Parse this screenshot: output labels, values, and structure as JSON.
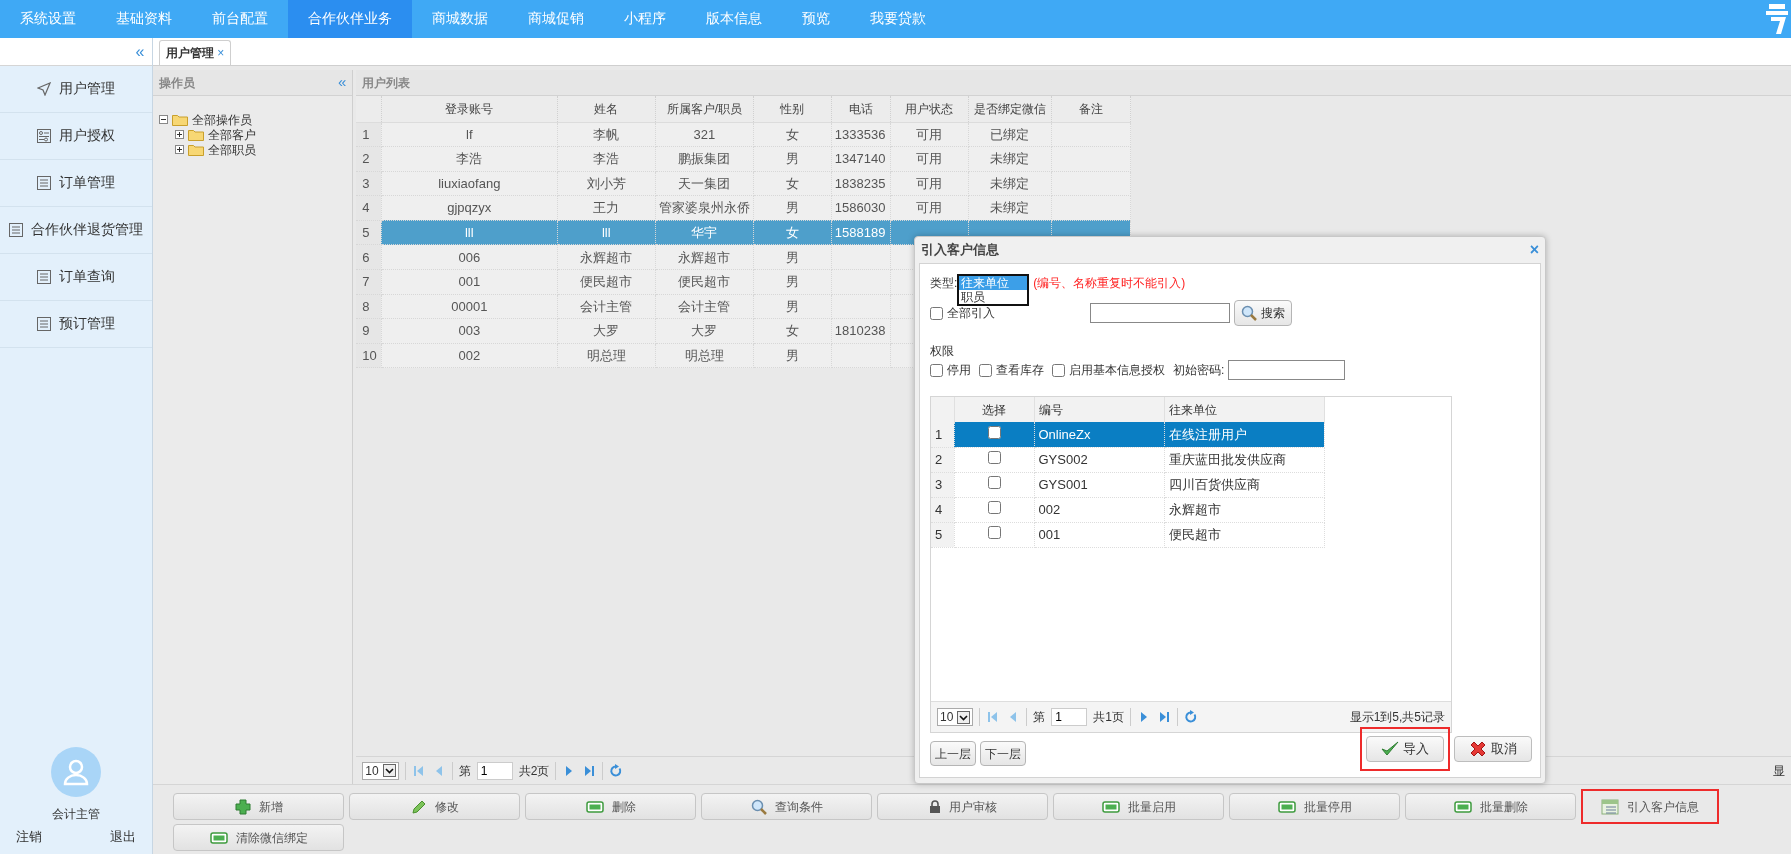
{
  "top_nav": {
    "items": [
      {
        "label": "系统设置",
        "selected": false
      },
      {
        "label": "基础资料",
        "selected": false
      },
      {
        "label": "前台配置",
        "selected": false
      },
      {
        "label": "合作伙伴业务",
        "selected": true
      },
      {
        "label": "商城数据",
        "selected": false
      },
      {
        "label": "商城促销",
        "selected": false
      },
      {
        "label": "小程序",
        "selected": false
      },
      {
        "label": "版本信息",
        "selected": false
      },
      {
        "label": "预览",
        "selected": false
      },
      {
        "label": "我要贷款",
        "selected": false
      }
    ]
  },
  "sidebar": {
    "collapse": "«",
    "items": [
      {
        "label": "用户管理"
      },
      {
        "label": "用户授权"
      },
      {
        "label": "订单管理"
      },
      {
        "label": "合作伙伴退货管理"
      },
      {
        "label": "订单查询"
      },
      {
        "label": "预订管理"
      }
    ],
    "user": {
      "name": "会计主管",
      "links": [
        "注销",
        "退出"
      ]
    }
  },
  "tabs": [
    {
      "label": "用户管理",
      "close": "×",
      "selected": true
    }
  ],
  "operator_panel": {
    "title": "操作员",
    "collapse": "«",
    "tree": [
      {
        "label": "全部操作员",
        "expanded": true,
        "children": [
          {
            "label": "全部客户",
            "expanded": false
          },
          {
            "label": "全部职员",
            "expanded": false
          }
        ]
      }
    ]
  },
  "user_list": {
    "title": "用户列表",
    "columns": [
      "登录账号",
      "姓名",
      "所属客户/职员",
      "性别",
      "电话",
      "用户状态",
      "是否绑定微信",
      "备注"
    ],
    "rows": [
      {
        "n": "1",
        "login": "lf",
        "name": "李帆",
        "owner": "321",
        "gender": "女",
        "phone": "1333536",
        "status": "可用",
        "wechat": "已绑定",
        "selected": false
      },
      {
        "n": "2",
        "login": "李浩",
        "name": "李浩",
        "owner": "鹏振集团",
        "gender": "男",
        "phone": "1347140",
        "status": "可用",
        "wechat": "未绑定",
        "selected": false
      },
      {
        "n": "3",
        "login": "liuxiaofang",
        "name": "刘小芳",
        "owner": "天一集团",
        "gender": "女",
        "phone": "1838235",
        "status": "可用",
        "wechat": "未绑定",
        "selected": false
      },
      {
        "n": "4",
        "login": "gjpqzyx",
        "name": "王力",
        "owner": "管家婆泉州永侨",
        "gender": "男",
        "phone": "1586030",
        "status": "可用",
        "wechat": "未绑定",
        "selected": false
      },
      {
        "n": "5",
        "login": "lll",
        "name": "lll",
        "owner": "华宇",
        "gender": "女",
        "phone": "1588189",
        "selected": true
      },
      {
        "n": "6",
        "login": "006",
        "name": "永辉超市",
        "owner": "永辉超市",
        "gender": "男",
        "selected": false
      },
      {
        "n": "7",
        "login": "001",
        "name": "便民超市",
        "owner": "便民超市",
        "gender": "男",
        "selected": false
      },
      {
        "n": "8",
        "login": "00001",
        "name": "会计主管",
        "owner": "会计主管",
        "gender": "男",
        "selected": false
      },
      {
        "n": "9",
        "login": "003",
        "name": "大罗",
        "owner": "大罗",
        "gender": "女",
        "phone": "1810238",
        "selected": false
      },
      {
        "n": "10",
        "login": "002",
        "name": "明总理",
        "owner": "明总理",
        "gender": "男",
        "selected": false
      }
    ],
    "pager": {
      "page_size": "10",
      "page_label": "第",
      "page": "1",
      "total": "共2页",
      "summary": "显"
    }
  },
  "toolbar": [
    {
      "label": "新增",
      "kind": "add",
      "highlighted": false
    },
    {
      "label": "修改",
      "kind": "edit",
      "highlighted": false
    },
    {
      "label": "删除",
      "kind": "bar",
      "highlighted": false
    },
    {
      "label": "查询条件",
      "kind": "search",
      "highlighted": false
    },
    {
      "label": "用户审核",
      "kind": "lock",
      "highlighted": false
    },
    {
      "label": "批量启用",
      "kind": "bar",
      "highlighted": false
    },
    {
      "label": "批量停用",
      "kind": "bar",
      "highlighted": false
    },
    {
      "label": "批量删除",
      "kind": "bar",
      "highlighted": false
    },
    {
      "label": "引入客户信息",
      "kind": "grid",
      "highlighted": true
    },
    {
      "label": "清除微信绑定",
      "kind": "bar",
      "highlighted": false
    }
  ],
  "dialog": {
    "title": "引入客户信息",
    "close": "×",
    "type_label": "类型:",
    "type_options": [
      {
        "label": "往来单位",
        "selected": true
      },
      {
        "label": "职员",
        "selected": false
      }
    ],
    "note": "(编号、名称重复时不能引入)",
    "import_all": {
      "label": "全部引入",
      "checked": false
    },
    "search_button": "搜索",
    "permissions_label": "权限",
    "permissions": [
      {
        "label": "停用",
        "checked": false
      },
      {
        "label": "查看库存",
        "checked": false
      },
      {
        "label": "启用基本信息授权",
        "checked": false
      }
    ],
    "password_label": "初始密码:",
    "grid": {
      "columns": [
        "选择",
        "编号",
        "往来单位"
      ],
      "rows": [
        {
          "n": "1",
          "code": "OnlineZx",
          "unit": "在线注册用户",
          "checked": false,
          "selected": true
        },
        {
          "n": "2",
          "code": "GYS002",
          "unit": "重庆蓝田批发供应商",
          "checked": false,
          "selected": false
        },
        {
          "n": "3",
          "code": "GYS001",
          "unit": "四川百货供应商",
          "checked": false,
          "selected": false
        },
        {
          "n": "4",
          "code": "002",
          "unit": "永辉超市",
          "checked": false,
          "selected": false
        },
        {
          "n": "5",
          "code": "001",
          "unit": "便民超市",
          "checked": false,
          "selected": false
        }
      ],
      "pager": {
        "page_size": "10",
        "page_label": "第",
        "page": "1",
        "total": "共1页",
        "summary": "显示1到5,共5记录"
      }
    },
    "nav_buttons": [
      "上一层",
      "下一层"
    ],
    "actions": [
      {
        "label": "导入",
        "kind": "ok",
        "highlighted": true
      },
      {
        "label": "取消",
        "kind": "cancel",
        "highlighted": false
      }
    ]
  }
}
